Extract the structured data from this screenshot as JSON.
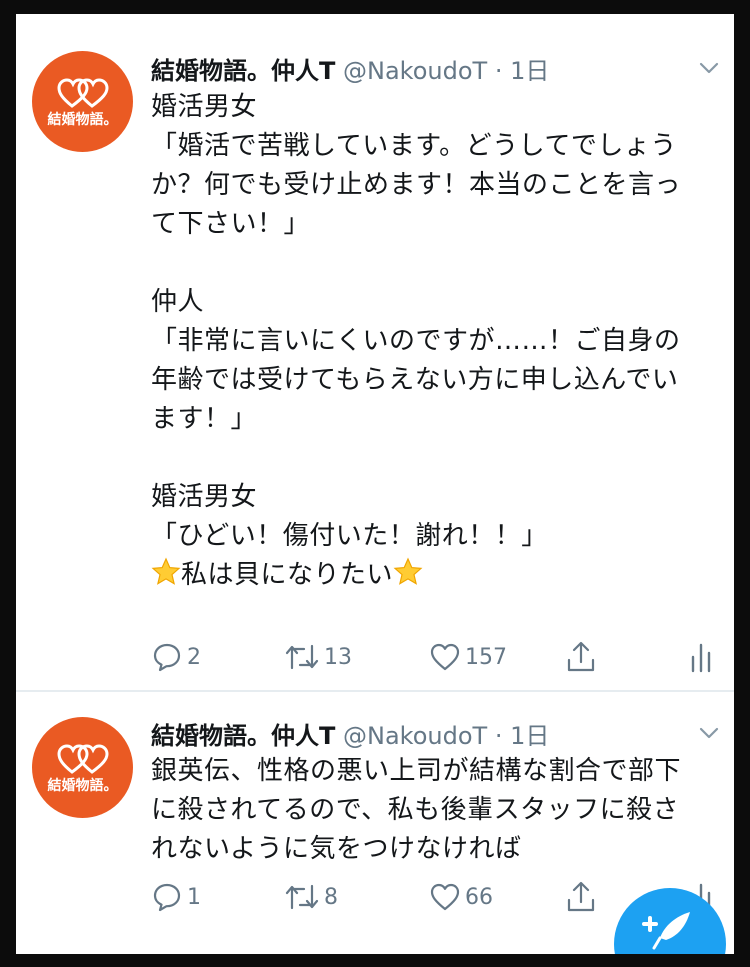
{
  "theme": {
    "accent": "#1da1f2",
    "avatar_bg": "#ea5a23",
    "muted": "#657786",
    "text": "#14171a"
  },
  "tweets": [
    {
      "author": {
        "name": "結婚物語。仲人T",
        "handle": "@NakoudoT",
        "time": "· 1日",
        "avatar_text": "結婚物語。",
        "avatar_icon": "double-heart-icon"
      },
      "text": "婚活男女\n「婚活で苦戦しています。どうしてでしょう\nか？何でも受け止めます！本当のことを言っ\nて下さい！」\n\n仲人\n「非常に言いにくいのですが……！ご自身の\n年齢では受けてもらえない方に申し込んでい\nます！」\n\n婚活男女\n「ひどい！傷付いた！謝れ！！」\n",
      "closing_line": "私は貝になりたい",
      "actions": {
        "replies": "2",
        "retweets": "13",
        "likes": "157"
      }
    },
    {
      "author": {
        "name": "結婚物語。仲人T",
        "handle": "@NakoudoT",
        "time": "· 1日",
        "avatar_text": "結婚物語。",
        "avatar_icon": "double-heart-icon"
      },
      "text": "銀英伝、性格の悪い上司が結構な割合で部下\nに殺されてるので、私も後輩スタッフに殺さ\nれないように気をつけなければ",
      "actions": {
        "replies": "1",
        "retweets": "8",
        "likes": "66"
      }
    }
  ],
  "icons": {
    "reply": "reply-icon",
    "retweet": "retweet-icon",
    "like": "heart-icon",
    "share": "share-icon",
    "analytics": "analytics-icon",
    "more": "chevron-down-icon",
    "compose": "compose-icon"
  }
}
